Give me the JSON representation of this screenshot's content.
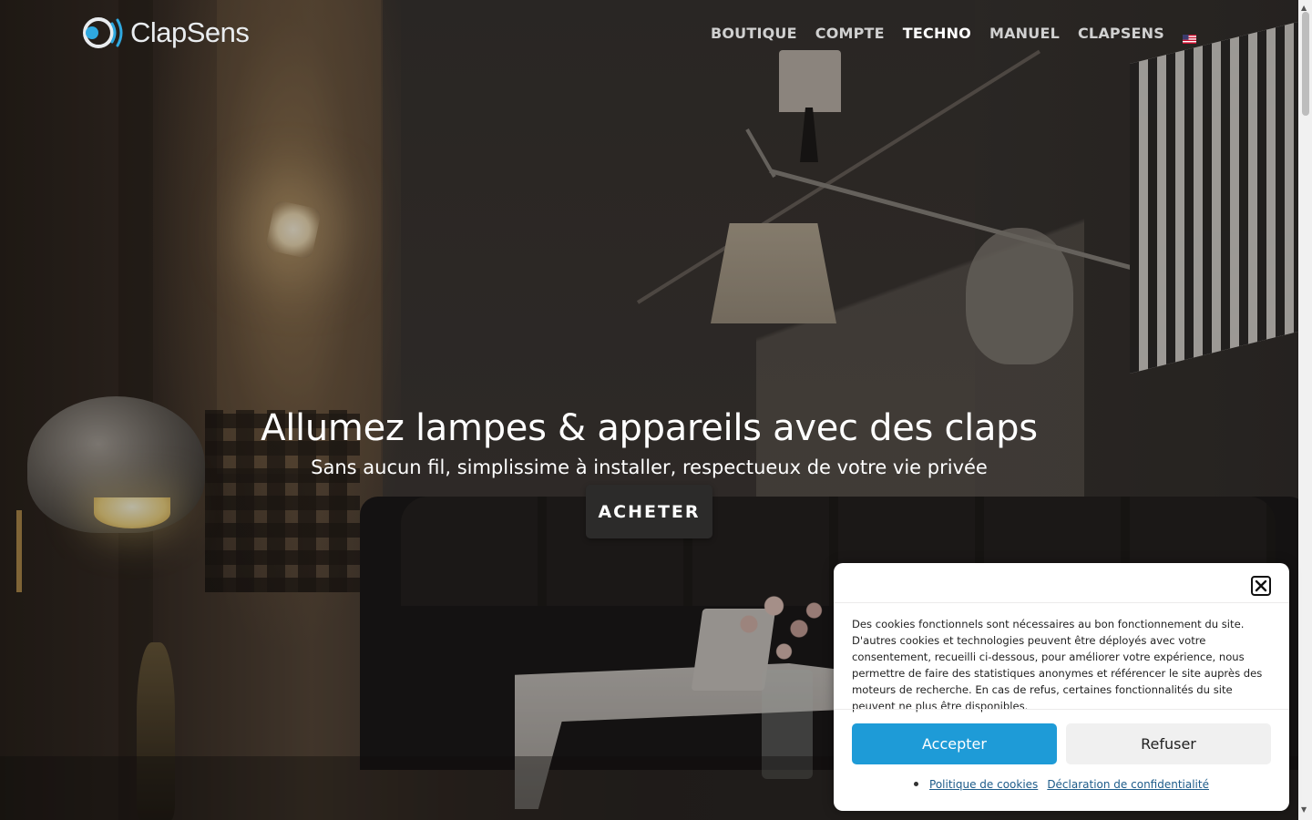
{
  "header": {
    "brand": "ClapSens",
    "nav": [
      {
        "label": "BOUTIQUE",
        "active": false
      },
      {
        "label": "COMPTE",
        "active": false
      },
      {
        "label": "TECHNO",
        "active": true
      },
      {
        "label": "MANUEL",
        "active": false
      },
      {
        "label": "CLAPSENS",
        "active": false
      }
    ],
    "language_flag": "us-flag-icon"
  },
  "hero": {
    "title": "Allumez lampes & appareils avec des claps",
    "subtitle": "Sans aucun fil, simplissime à installer, respectueux de votre vie privée",
    "cta_label": "ACHETER"
  },
  "cookie_banner": {
    "text": "Des cookies fonctionnels sont nécessaires au bon fonctionnement du site. D'autres cookies et technologies peuvent être déployés avec votre consentement, recueilli ci-dessous, pour améliorer votre expérience, nous permettre de faire des statistiques anonymes et référencer le site auprès des moteurs de recherche. En cas de refus, certaines fonctionnalités du site peuvent ne plus être disponibles.",
    "accept_label": "Accepter",
    "refuse_label": "Refuser",
    "links": [
      "Politique de cookies",
      "Déclaration de confidentialité"
    ]
  },
  "colors": {
    "accent": "#1e9bd7",
    "logo_accent": "#2fa8df",
    "cta_bg": "#2c2b2a"
  }
}
